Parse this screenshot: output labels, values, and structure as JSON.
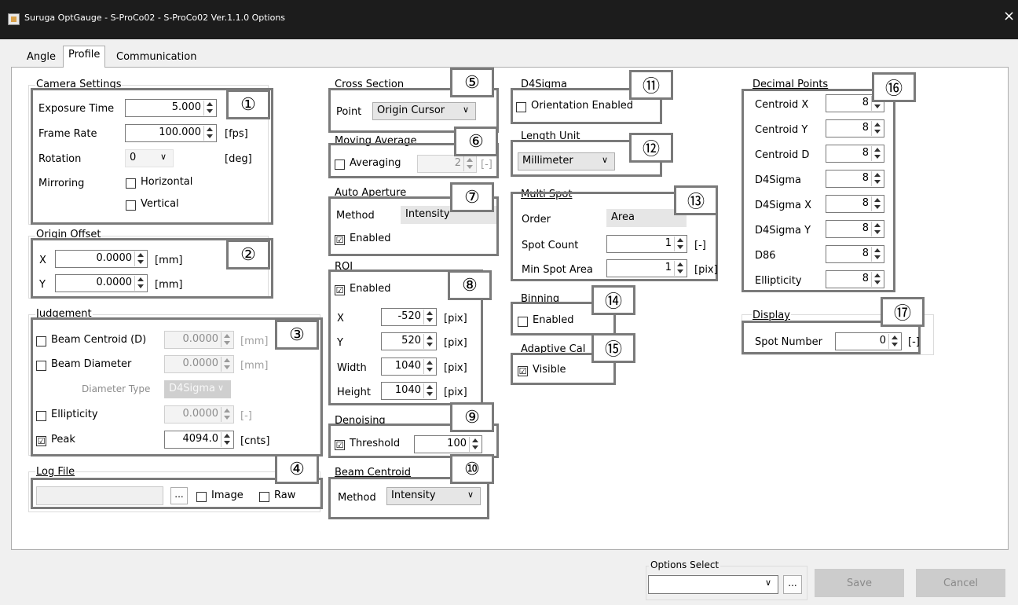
{
  "window": {
    "title": "Suruga OptGauge - S-ProCo02 - S-ProCo02 Ver.1.1.0 Options",
    "close_glyph": "×"
  },
  "tabs": [
    {
      "label": "Angle",
      "active": false
    },
    {
      "label": "Profile",
      "active": true
    },
    {
      "label": "Communication",
      "active": false
    }
  ],
  "markers": [
    "①",
    "②",
    "③",
    "④",
    "⑤",
    "⑥",
    "⑦",
    "⑧",
    "⑨",
    "⑩",
    "⑪",
    "⑫",
    "⑬",
    "⑭",
    "⑮",
    "⑯",
    "⑰"
  ],
  "icons": {
    "check": "☑",
    "dropdown": "∨",
    "browse": "..."
  },
  "camera_settings": {
    "legend": "Camera Settings",
    "exposure_label": "Exposure Time",
    "exposure_value": "5.000",
    "frame_rate_label": "Frame Rate",
    "frame_rate_value": "100.000",
    "frame_rate_unit": "[fps]",
    "rotation_label": "Rotation",
    "rotation_value": "0",
    "rotation_unit": "[deg]",
    "mirroring_label": "Mirroring",
    "horizontal_label": "Horizontal",
    "horizontal_checked": false,
    "vertical_label": "Vertical",
    "vertical_checked": false
  },
  "origin_offset": {
    "legend": "Origin Offset",
    "x_label": "X",
    "x_value": "0.0000",
    "x_unit": "[mm]",
    "y_label": "Y",
    "y_value": "0.0000",
    "y_unit": "[mm]"
  },
  "judgement": {
    "legend": "Judgement",
    "beam_centroid_label": "Beam Centroid (D)",
    "beam_centroid_checked": false,
    "beam_centroid_value": "0.0000",
    "beam_centroid_unit": "[mm]",
    "beam_diameter_label": "Beam Diameter",
    "beam_diameter_checked": false,
    "beam_diameter_value": "0.0000",
    "beam_diameter_unit": "[mm]",
    "diameter_type_label": "Diameter Type",
    "diameter_type_value": "D4Sigma",
    "ellipticity_label": "Ellipticity",
    "ellipticity_checked": false,
    "ellipticity_value": "0.0000",
    "ellipticity_unit": "[-]",
    "peak_label": "Peak",
    "peak_checked": true,
    "peak_value": "4094.0",
    "peak_unit": "[cnts]"
  },
  "log_file": {
    "legend": "Log File",
    "path_value": "",
    "image_label": "Image",
    "image_checked": false,
    "raw_label": "Raw",
    "raw_checked": false
  },
  "cross_section": {
    "legend": "Cross Section",
    "point_label": "Point",
    "point_value": "Origin Cursor"
  },
  "moving_average": {
    "legend": "Moving Average",
    "averaging_label": "Averaging",
    "averaging_checked": false,
    "averaging_value": "2",
    "averaging_unit": "[-]"
  },
  "auto_aperture": {
    "legend": "Auto Aperture",
    "method_label": "Method",
    "method_value": "Intensity",
    "enabled_label": "Enabled",
    "enabled_checked": true
  },
  "roi": {
    "legend": "ROI",
    "enabled_label": "Enabled",
    "enabled_checked": true,
    "x_label": "X",
    "x_value": "-520",
    "x_unit": "[pix]",
    "y_label": "Y",
    "y_value": "520",
    "y_unit": "[pix]",
    "width_label": "Width",
    "width_value": "1040",
    "width_unit": "[pix]",
    "height_label": "Height",
    "height_value": "1040",
    "height_unit": "[pix]"
  },
  "denoising": {
    "legend": "Denoising",
    "threshold_label": "Threshold",
    "threshold_checked": true,
    "threshold_value": "100"
  },
  "beam_centroid": {
    "legend": "Beam Centroid",
    "method_label": "Method",
    "method_value": "Intensity"
  },
  "d4sigma": {
    "legend": "D4Sigma",
    "orientation_label": "Orientation Enabled",
    "orientation_checked": false
  },
  "length_unit": {
    "legend": "Length Unit",
    "value": "Millimeter"
  },
  "multi_spot": {
    "legend": "Multi Spot",
    "order_label": "Order",
    "order_value": "Area",
    "spot_count_label": "Spot Count",
    "spot_count_value": "1",
    "spot_count_unit": "[-]",
    "min_spot_area_label": "Min Spot Area",
    "min_spot_area_value": "1",
    "min_spot_area_unit": "[pix]"
  },
  "binning": {
    "legend": "Binning",
    "enabled_label": "Enabled",
    "enabled_checked": false
  },
  "adaptive_cal": {
    "legend": "Adaptive Cal",
    "visible_label": "Visible",
    "visible_checked": true
  },
  "decimal_points": {
    "legend": "Decimal Points",
    "items": [
      {
        "label": "Centroid X",
        "value": "8"
      },
      {
        "label": "Centroid Y",
        "value": "8"
      },
      {
        "label": "Centroid D",
        "value": "8"
      },
      {
        "label": "D4Sigma",
        "value": "8"
      },
      {
        "label": "D4Sigma X",
        "value": "8"
      },
      {
        "label": "D4Sigma Y",
        "value": "8"
      },
      {
        "label": "D86",
        "value": "8"
      },
      {
        "label": "Ellipticity",
        "value": "8"
      }
    ]
  },
  "display": {
    "legend": "Display",
    "spot_number_label": "Spot Number",
    "spot_number_value": "0",
    "spot_number_unit": "[-]"
  },
  "footer": {
    "options_select_label": "Options Select",
    "options_select_value": "",
    "save_label": "Save",
    "cancel_label": "Cancel"
  }
}
